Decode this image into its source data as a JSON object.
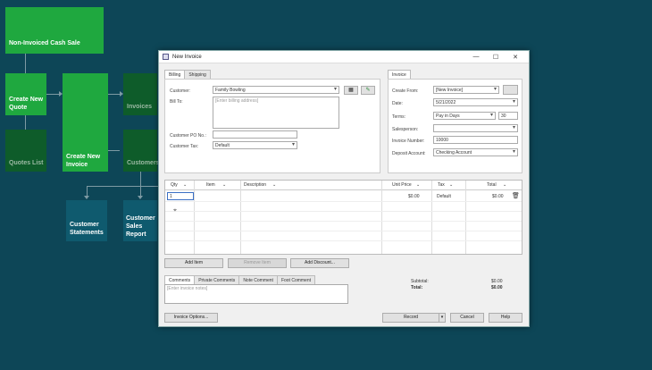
{
  "flow": {
    "non_invoiced": "Non-Invoiced Cash Sale",
    "create_quote": "Create New Quote",
    "create_invoice": "Create New Invoice",
    "invoices": "Invoices",
    "quotes_list": "Quotes List",
    "customers": "Customers",
    "customer_statements": "Customer Statements",
    "customer_sales_report": "Customer Sales Report"
  },
  "window": {
    "title": "New Invoice",
    "minimize": "—",
    "maximize": "☐",
    "close": "✕"
  },
  "billing": {
    "tabs": [
      "Billing",
      "Shipping"
    ],
    "customer_label": "Customer:",
    "customer_value": "Family Bowling",
    "bill_to_label": "Bill To:",
    "bill_to_placeholder": "[Enter billing address]",
    "po_label": "Customer PO No.:",
    "po_value": "",
    "tax_label": "Customer Tax:",
    "tax_value": "Default"
  },
  "invoice": {
    "tab": "Invoice",
    "create_from_label": "Create From:",
    "create_from_value": "[New Invoice]",
    "date_label": "Date:",
    "date_value": "5/21/2022",
    "terms_label": "Terms:",
    "terms_value": "Pay in Days",
    "terms_days": "30",
    "salesperson_label": "Salesperson:",
    "salesperson_value": "",
    "invoice_number_label": "Invoice Number:",
    "invoice_number_value": "10000",
    "deposit_label": "Deposit Account:",
    "deposit_value": "Checking Account"
  },
  "grid": {
    "columns": [
      "Qty",
      "Item",
      "Description",
      "Unit Price",
      "Tax",
      "Total"
    ],
    "row": {
      "qty": "1",
      "unit_price": "$0.00",
      "tax": "Default",
      "total": "$0.00"
    }
  },
  "actions": {
    "add_item": "Add Item",
    "remove_item": "Remove Item",
    "add_discount": "Add Discount..."
  },
  "comments": {
    "tabs": [
      "Comments",
      "Private Comments",
      "Note Comment",
      "Foot Comment"
    ],
    "placeholder": "[Enter invoice notes]"
  },
  "totals": {
    "subtotal_label": "Subtotal:",
    "subtotal_value": "$0.00",
    "total_label": "Total:",
    "total_value": "$0.00"
  },
  "footer": {
    "options": "Invoice Options...",
    "record": "Record",
    "cancel": "Cancel",
    "help": "Help"
  }
}
